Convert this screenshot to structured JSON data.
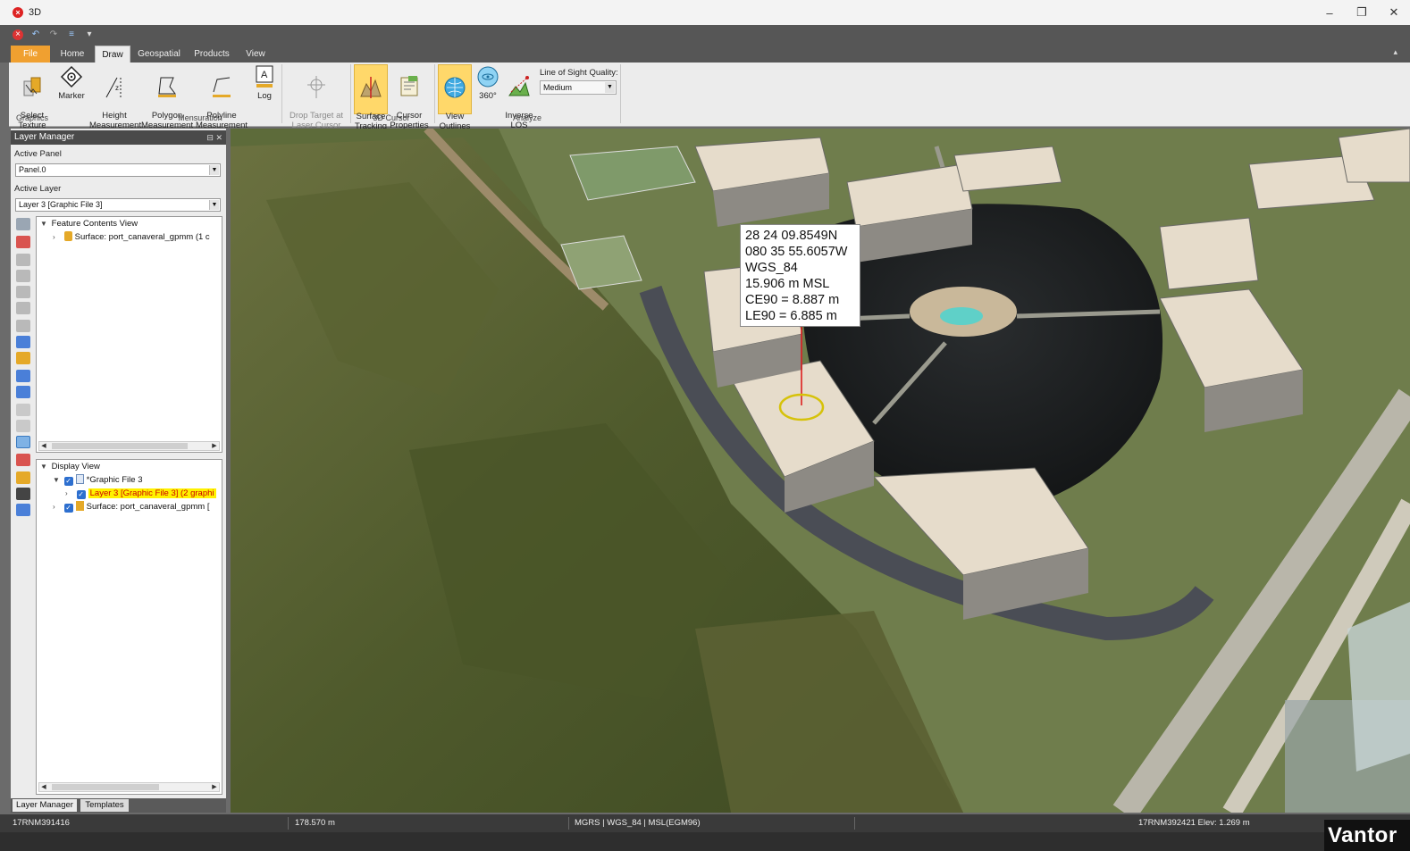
{
  "window": {
    "title": "3D",
    "app_icon": "app-close-icon"
  },
  "ribbon_tabs": [
    "File",
    "Home",
    "Draw",
    "Geospatial",
    "Products",
    "View"
  ],
  "active_tab": "Draw",
  "ribbon": {
    "select_texture": "Select\nTexture",
    "marker": "Marker",
    "height_measurement": "Height\nMeasurement",
    "polygon_measurement": "Polygon\nMeasurement",
    "polyline_measurement": "Polyline\nMeasurement",
    "log": "Log",
    "drop_target": "Drop Target at\nLaser Cursor",
    "surface_tracking": "Surface\nTracking",
    "cursor_properties": "Cursor\nProperties",
    "view_outlines": "View\nOutlines",
    "three_sixty": "360°",
    "inverse_los": "Inverse\nLOS",
    "los_quality_label": "Line of Sight Quality:",
    "los_quality_value": "Medium",
    "groups": {
      "graphics": "Graphics",
      "mensuration": "Mensuration",
      "cursor3d": "3D Cursor",
      "analyze": "Analyze"
    }
  },
  "layer_manager": {
    "title": "Layer Manager",
    "active_panel_label": "Active Panel",
    "active_panel_value": "Panel.0",
    "active_layer_label": "Active Layer",
    "active_layer_value": "Layer 3 [Graphic File 3]",
    "feature_contents": {
      "header": "Feature Contents View",
      "items": [
        "Surface: port_canaveral_gpmm  (1 c"
      ]
    },
    "display_view": {
      "header": "Display View",
      "graphic_file": "*Graphic File 3",
      "layer": "Layer 3 [Graphic File 3]  (2 graphi",
      "surface": "Surface: port_canaveral_gpmm ["
    },
    "bottom_tabs": [
      "Layer Manager",
      "Templates"
    ]
  },
  "readout": {
    "lat": "28 24 09.8549N",
    "lon": "080 35 55.6057W",
    "datum": "WGS_84",
    "elev": "15.906 m MSL",
    "ce90": "CE90 = 8.887 m",
    "le90": "LE90 = 6.885 m"
  },
  "status": {
    "mgrs_left": "17RNM391416",
    "distance": "178.570 m",
    "coord_system": "MGRS | WGS_84 | MSL(EGM96)",
    "mgrs_right": "17RNM392421 Elev: 1.269 m"
  },
  "logo": "Vantor"
}
